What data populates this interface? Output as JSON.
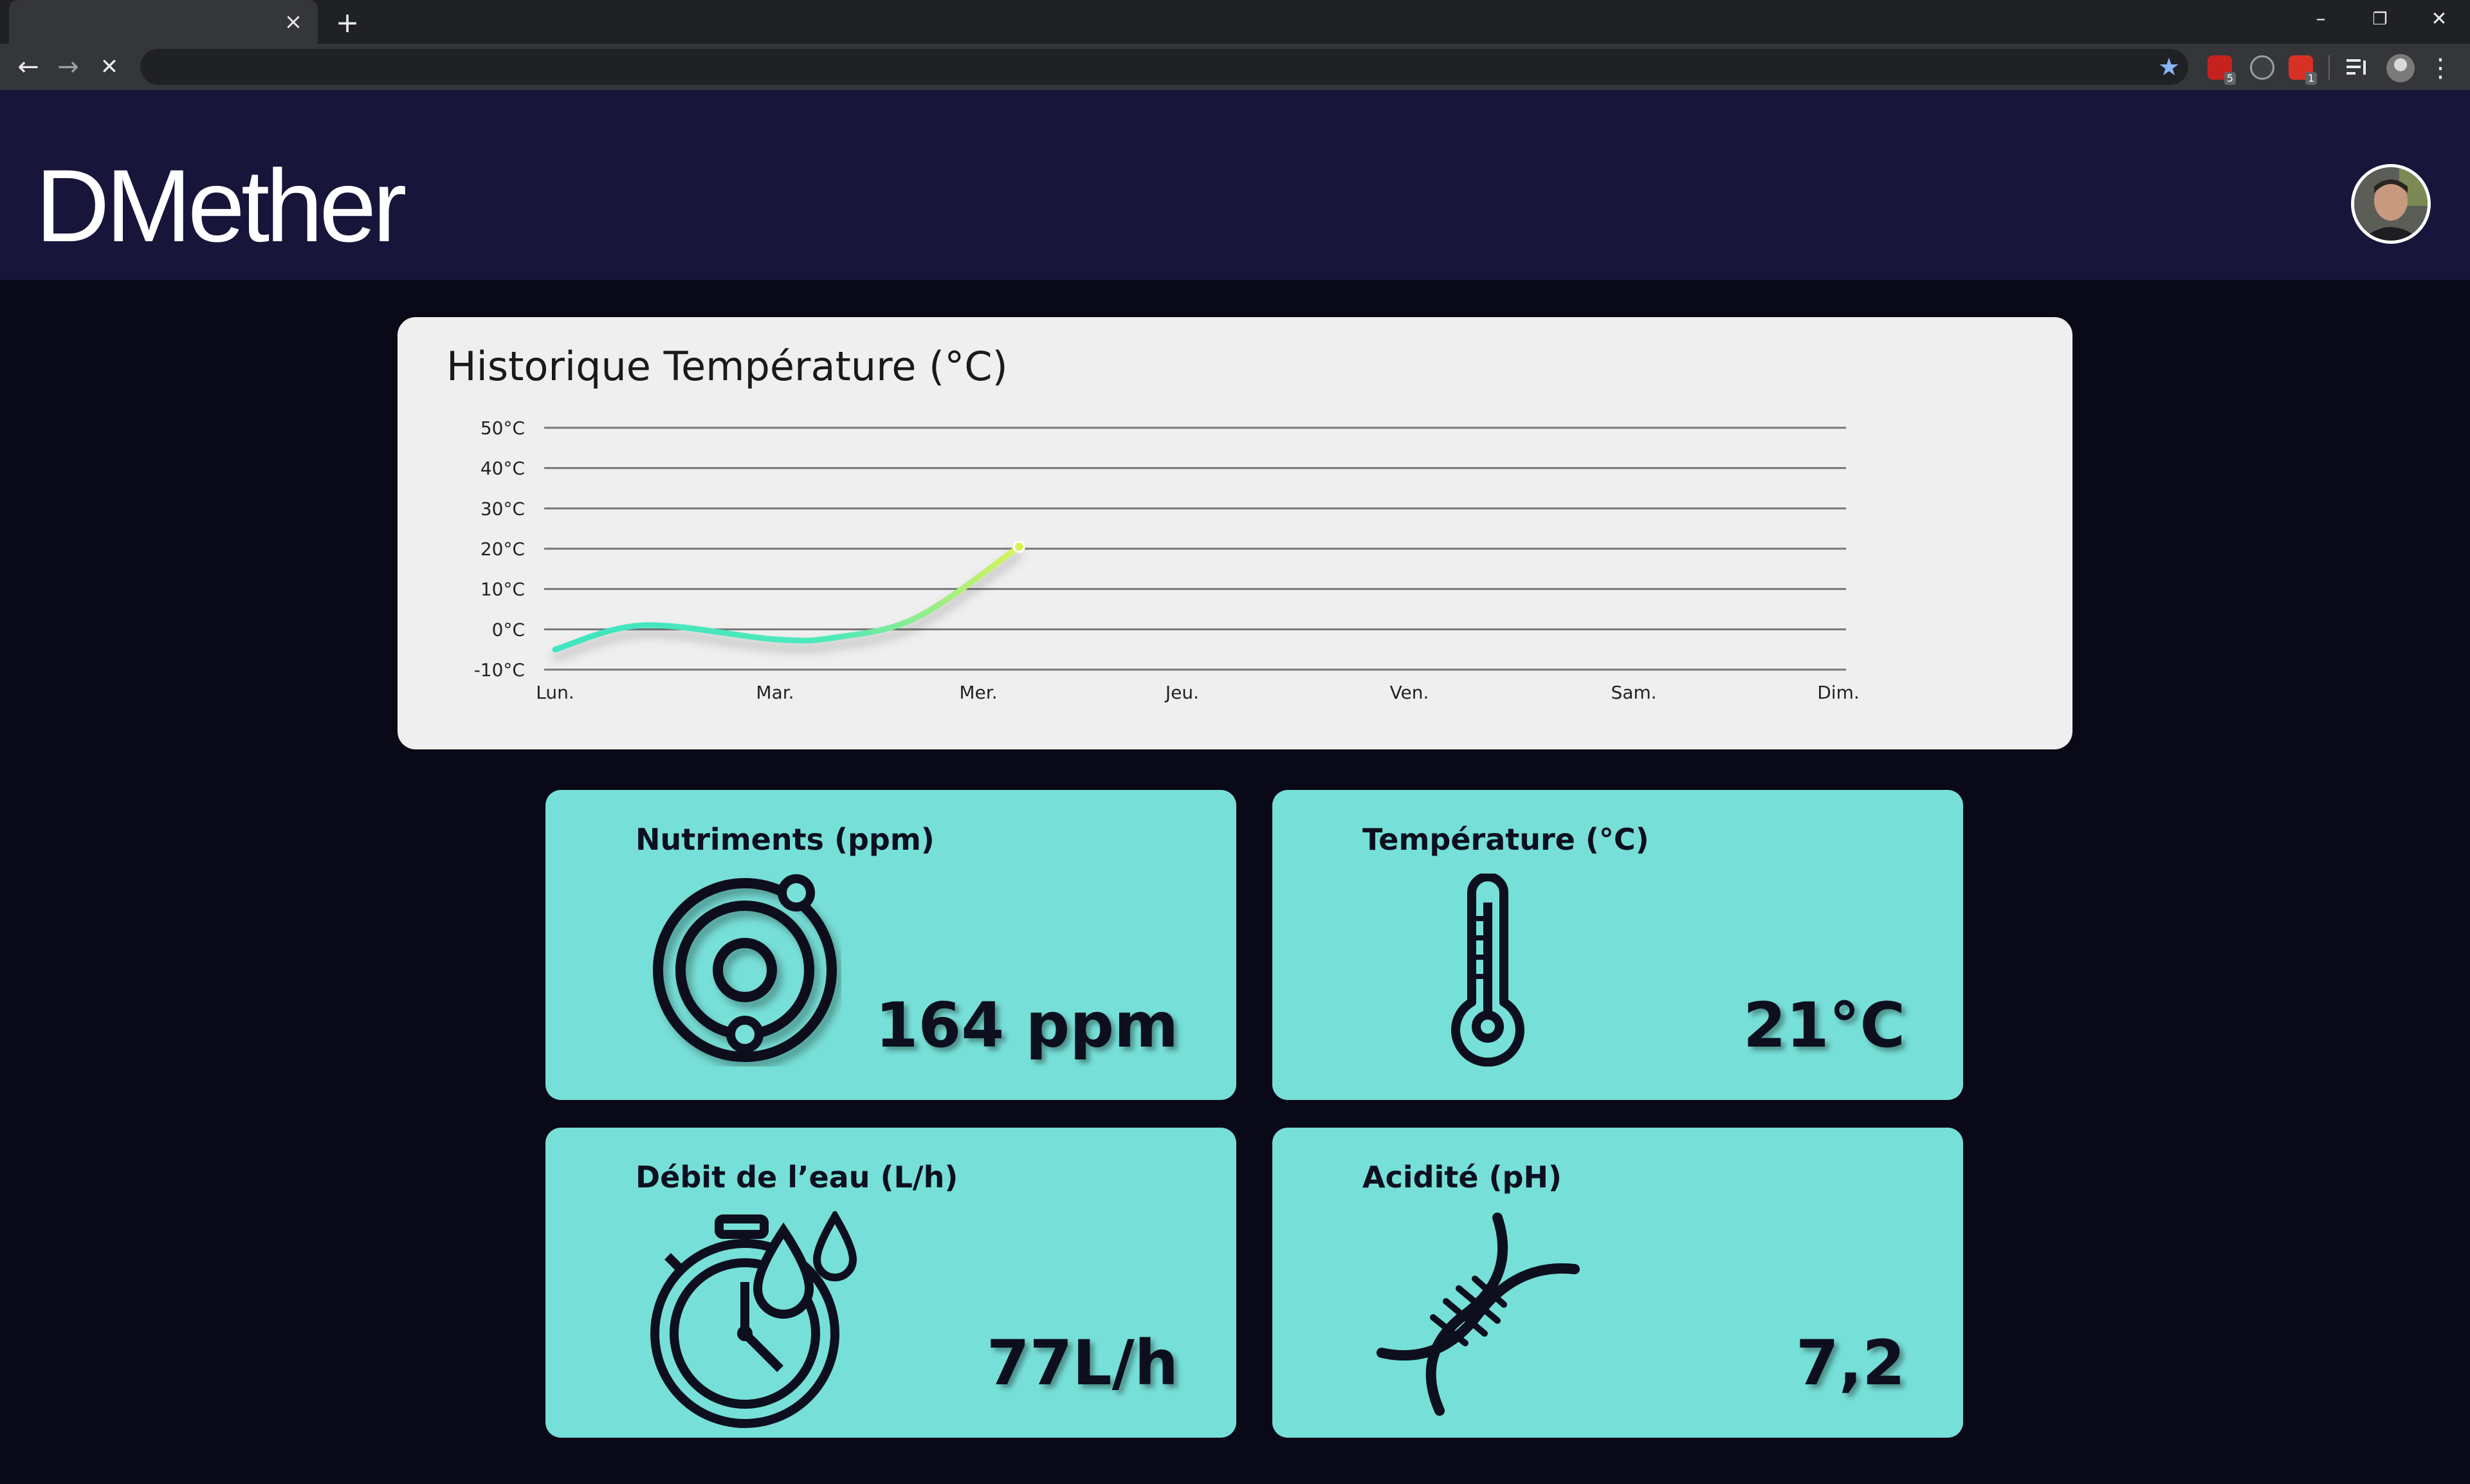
{
  "browser": {
    "tab_close": "×",
    "new_tab": "+",
    "win_min": "–",
    "win_restore": "❐",
    "win_close": "✕",
    "back": "←",
    "forward": "→",
    "stop": "✕",
    "star": "★",
    "menu": "⋮",
    "ext_badge_1": "5",
    "ext_badge_2": "1"
  },
  "header": {
    "brand": "DMether"
  },
  "chart_card": {
    "title": "Historique Température (°C)"
  },
  "chart_data": {
    "type": "line",
    "title": "Historique Température (°C)",
    "categories": [
      "Lun.",
      "Mar.",
      "Mer.",
      "Jeu.",
      "Ven.",
      "Sam.",
      "Dim."
    ],
    "y_ticks": [
      "50°C",
      "40°C",
      "30°C",
      "20°C",
      "10°C",
      "0°C",
      "-10°C"
    ],
    "ylim": [
      -10,
      50
    ],
    "grid": true,
    "series": [
      {
        "x": [
          0,
          0.4,
          1,
          1.3,
          1.7,
          2.2
        ],
        "values": [
          -5,
          1,
          -2.5,
          -2,
          3,
          20.5
        ]
      }
    ],
    "colors": {
      "line_start": "#3fe5c0",
      "line_end": "#d8f35a",
      "grid": "#777777"
    }
  },
  "metrics": [
    {
      "title": "Nutriments (ppm)",
      "value": "164 ppm",
      "icon": "orbit-icon"
    },
    {
      "title": "Température (°C)",
      "value": "21°C",
      "icon": "thermometer-icon"
    },
    {
      "title": "Débit de l’eau (L/h)",
      "value": "77L/h",
      "icon": "stopwatch-drop-icon"
    },
    {
      "title": "Acidité (pH)",
      "value": "7,2",
      "icon": "dna-icon"
    }
  ],
  "colors": {
    "page_bg": "#0a0918",
    "header_bg": "#17153a",
    "card_bg": "#76dfd7",
    "chart_bg": "#efefef"
  }
}
